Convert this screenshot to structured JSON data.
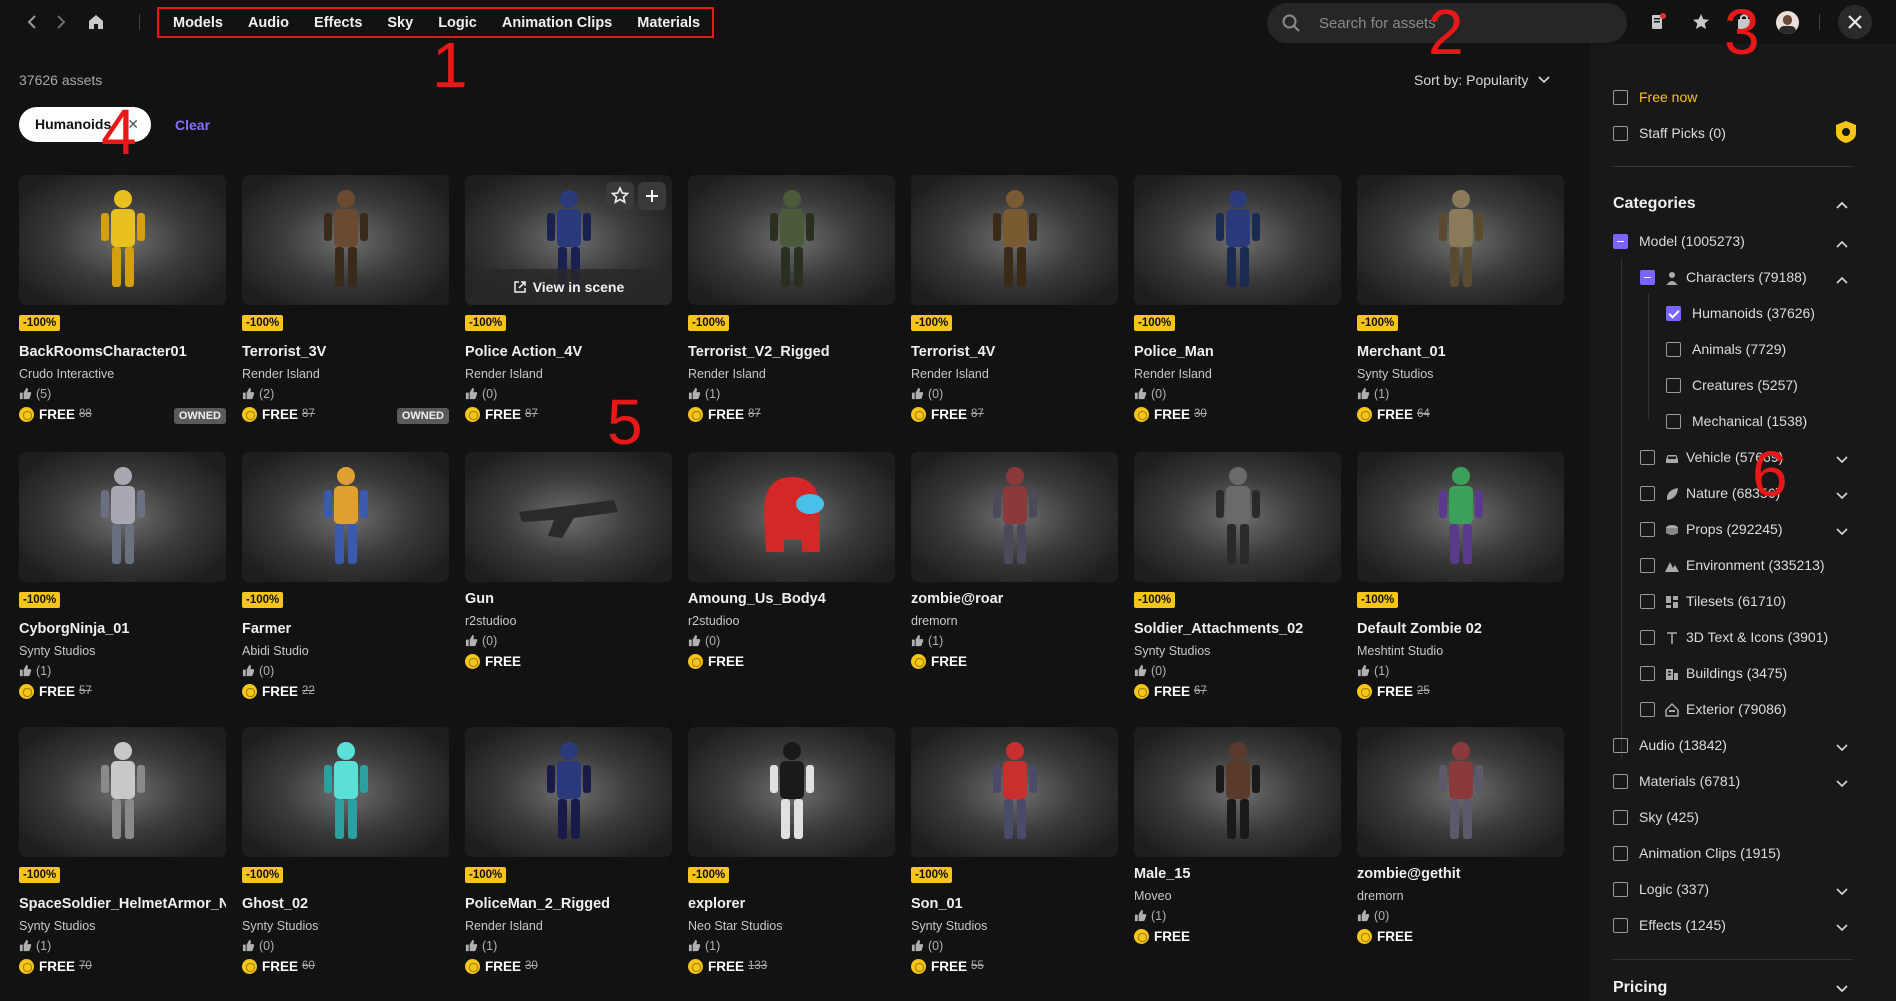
{
  "nav": {
    "tabs": [
      "Models",
      "Audio",
      "Effects",
      "Sky",
      "Logic",
      "Animation Clips",
      "Materials"
    ]
  },
  "search": {
    "placeholder": "Search for assets"
  },
  "annotations": [
    "1",
    "2",
    "3",
    "4",
    "5",
    "6"
  ],
  "results": {
    "count": "37626 assets",
    "sort": "Sort by: Popularity",
    "active_filter": "Humanoids",
    "clear_label": "Clear"
  },
  "card_actions": {
    "view_in_scene": "View in scene"
  },
  "assets": [
    {
      "title": "BackRoomsCharacter01",
      "author": "Crudo Interactive",
      "likes": "(5)",
      "badge": "-100%",
      "price": "FREE",
      "old_price": "88",
      "owned": "OWNED"
    },
    {
      "title": "Terrorist_3V",
      "author": "Render Island",
      "likes": "(2)",
      "badge": "-100%",
      "price": "FREE",
      "old_price": "87",
      "owned": "OWNED"
    },
    {
      "title": "Police Action_4V",
      "author": "Render Island",
      "likes": "(0)",
      "badge": "-100%",
      "price": "FREE",
      "old_price": "87"
    },
    {
      "title": "Terrorist_V2_Rigged",
      "author": "Render Island",
      "likes": "(1)",
      "badge": "-100%",
      "price": "FREE",
      "old_price": "87"
    },
    {
      "title": "Terrorist_4V",
      "author": "Render Island",
      "likes": "(0)",
      "badge": "-100%",
      "price": "FREE",
      "old_price": "87"
    },
    {
      "title": "Police_Man",
      "author": "Render Island",
      "likes": "(0)",
      "badge": "-100%",
      "price": "FREE",
      "old_price": "30"
    },
    {
      "title": "Merchant_01",
      "author": "Synty Studios",
      "likes": "(1)",
      "badge": "-100%",
      "price": "FREE",
      "old_price": "64"
    },
    {
      "title": "CyborgNinja_01",
      "author": "Synty Studios",
      "likes": "(1)",
      "badge": "-100%",
      "price": "FREE",
      "old_price": "57"
    },
    {
      "title": "Farmer",
      "author": "Abidi Studio",
      "likes": "(0)",
      "badge": "-100%",
      "price": "FREE",
      "old_price": "22"
    },
    {
      "title": "Gun",
      "author": "r2studioo",
      "likes": "(0)",
      "price": "FREE"
    },
    {
      "title": "Amoung_Us_Body4",
      "author": "r2studioo",
      "likes": "(0)",
      "price": "FREE"
    },
    {
      "title": "zombie@roar",
      "author": "dremorn",
      "likes": "(1)",
      "price": "FREE"
    },
    {
      "title": "Soldier_Attachments_02",
      "author": "Synty Studios",
      "likes": "(0)",
      "badge": "-100%",
      "price": "FREE",
      "old_price": "67"
    },
    {
      "title": "Default Zombie 02",
      "author": "Meshtint Studio",
      "likes": "(1)",
      "badge": "-100%",
      "price": "FREE",
      "old_price": "25"
    },
    {
      "title": "SpaceSoldier_HelmetArmor_N",
      "author": "Synty Studios",
      "likes": "(1)",
      "badge": "-100%",
      "price": "FREE",
      "old_price": "70"
    },
    {
      "title": "Ghost_02",
      "author": "Synty Studios",
      "likes": "(0)",
      "badge": "-100%",
      "price": "FREE",
      "old_price": "60"
    },
    {
      "title": "PoliceMan_2_Rigged",
      "author": "Render Island",
      "likes": "(1)",
      "badge": "-100%",
      "price": "FREE",
      "old_price": "30"
    },
    {
      "title": "explorer",
      "author": "Neo Star Studios",
      "likes": "(1)",
      "badge": "-100%",
      "price": "FREE",
      "old_price": "133"
    },
    {
      "title": "Son_01",
      "author": "Synty Studios",
      "likes": "(0)",
      "badge": "-100%",
      "price": "FREE",
      "old_price": "55"
    },
    {
      "title": "Male_15",
      "author": "Moveo",
      "likes": "(1)",
      "price": "FREE"
    },
    {
      "title": "zombie@gethit",
      "author": "dremorn",
      "likes": "(0)",
      "price": "FREE"
    }
  ],
  "filters": {
    "free_now": "Free now",
    "staff_picks": "Staff Picks (0)",
    "categories_title": "Categories",
    "model": "Model (1005273)",
    "characters": "Characters (79188)",
    "humanoids": "Humanoids (37626)",
    "animals": "Animals (7729)",
    "creatures": "Creatures (5257)",
    "mechanical": "Mechanical (1538)",
    "vehicle": "Vehicle (57669)",
    "nature": "Nature (68356)",
    "props": "Props (292245)",
    "environment": "Environment (335213)",
    "tilesets": "Tilesets (61710)",
    "text_icons": "3D Text & Icons (3901)",
    "buildings": "Buildings (3475)",
    "exterior": "Exterior (79086)",
    "audio": "Audio (13842)",
    "materials": "Materials (6781)",
    "sky": "Sky (425)",
    "animation_clips": "Animation Clips (1915)",
    "logic": "Logic (337)",
    "effects": "Effects (1245)",
    "pricing_title": "Pricing"
  },
  "colors": {
    "accent": "#7a66ff",
    "discount_badge": "#f5c518",
    "annotation": "#e81818",
    "free_now": "#f5c518"
  }
}
